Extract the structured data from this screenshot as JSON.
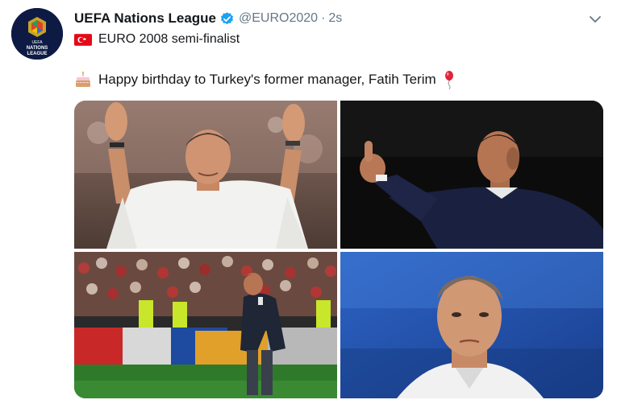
{
  "account": {
    "display_name": "UEFA Nations League",
    "handle": "@EURO2020",
    "separator": "·",
    "timestamp": "2s",
    "bio": "EURO 2008 semi-finalist",
    "avatar_text": [
      "UEFA",
      "NATIONS",
      "LEAGUE"
    ]
  },
  "tweet": {
    "text": "Happy birthday to Turkey's former manager, Fatih Terim",
    "leading_emoji": "birthday-cake-icon",
    "trailing_emoji": "balloon-icon"
  },
  "media": {
    "count": 4,
    "photos": [
      {
        "subject": "manager-waving-white-shirt"
      },
      {
        "subject": "manager-thumbs-up-dark"
      },
      {
        "subject": "manager-touchline-crowd"
      },
      {
        "subject": "manager-portrait-blue"
      }
    ]
  },
  "colors": {
    "name": "#14171a",
    "secondary": "#657786",
    "verified": "#1da1f2",
    "flag_red": "#e30a17"
  },
  "icons": {
    "verified": "verified-badge-icon",
    "menu": "chevron-down-icon",
    "flag": "turkey-flag-icon"
  }
}
